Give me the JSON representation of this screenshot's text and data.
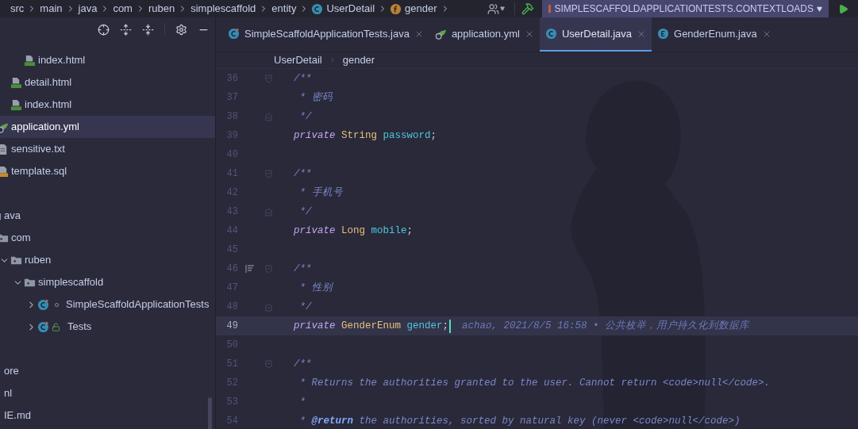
{
  "nav_bar": {
    "crumbs": [
      {
        "label": "src",
        "kind": "folder"
      },
      {
        "label": "main",
        "kind": "folder"
      },
      {
        "label": "java",
        "kind": "folder"
      },
      {
        "label": "com",
        "kind": "folder"
      },
      {
        "label": "ruben",
        "kind": "folder"
      },
      {
        "label": "simplescaffold",
        "kind": "folder"
      },
      {
        "label": "entity",
        "kind": "folder"
      },
      {
        "label": "UserDetail",
        "kind": "class"
      },
      {
        "label": "gender",
        "kind": "field"
      }
    ],
    "run_config": "SIMPLESCAFFOLDAPPLICATIONTESTS.CONTEXTLOADS"
  },
  "project_tree": {
    "sections": [
      {
        "items": [
          {
            "children": [
              {
                "children": [
                  {
                    "children": [
                      {
                        "label": "index.html",
                        "kind": "html",
                        "selected": false
                      }
                    ]
                  },
                  {
                    "label": "detail.html",
                    "kind": "html",
                    "selected": false
                  },
                  {
                    "label": "index.html",
                    "kind": "html",
                    "selected": false
                  }
                ]
              },
              {
                "label": "application.yml",
                "kind": "yaml",
                "selected": true
              },
              {
                "label": "sensitive.txt",
                "kind": "text",
                "selected": false
              },
              {
                "label": "template.sql",
                "kind": "sql",
                "selected": false
              }
            ]
          }
        ]
      },
      {
        "items": [
          {
            "label": "ava",
            "kind": "folder",
            "selected": false,
            "children": [
              {
                "label": "com",
                "kind": "package",
                "selected": false,
                "children": [
                  {
                    "label": "ruben",
                    "kind": "package",
                    "selected": false,
                    "expanded": true,
                    "children": [
                      {
                        "label": "simplescaffold",
                        "kind": "package",
                        "selected": false,
                        "expanded": true,
                        "children": [
                          {
                            "label": "SimpleScaffoldApplicationTests",
                            "kind": "test_class",
                            "public": false,
                            "selected": false,
                            "expanded": false
                          },
                          {
                            "label": "Tests",
                            "kind": "test_class",
                            "public": true,
                            "selected": false,
                            "expanded": false
                          }
                        ]
                      }
                    ]
                  }
                ]
              }
            ]
          }
        ]
      },
      {
        "items": [
          {
            "label": "ore",
            "kind": "file",
            "selected": false
          },
          {
            "label": "nl",
            "kind": "file",
            "selected": false
          },
          {
            "label": "IE.md",
            "kind": "file",
            "selected": false
          }
        ]
      }
    ]
  },
  "editor": {
    "tabs": [
      {
        "label": "SimpleScaffoldApplicationTests.java",
        "kind": "test_class",
        "selected": false
      },
      {
        "label": "application.yml",
        "kind": "yaml",
        "selected": false
      },
      {
        "label": "UserDetail.java",
        "kind": "class",
        "selected": true
      },
      {
        "label": "GenderEnum.java",
        "kind": "enum",
        "selected": false
      }
    ],
    "breadcrumb": [
      "UserDetail",
      "gender"
    ],
    "lines": [
      {
        "number": "36",
        "fold_start": true,
        "current": false,
        "tokens": [
          {
            "kind": "comment",
            "text": "/**"
          }
        ]
      },
      {
        "number": "37",
        "current": false,
        "tokens": [
          {
            "kind": "comment",
            "text": " * 密码"
          }
        ]
      },
      {
        "number": "38",
        "fold_end": true,
        "current": false,
        "tokens": [
          {
            "kind": "comment",
            "text": " */"
          }
        ]
      },
      {
        "number": "39",
        "current": false,
        "tokens": [
          {
            "kind": "keyword",
            "text": "private "
          },
          {
            "kind": "type",
            "text": "String "
          },
          {
            "kind": "field",
            "text": "password"
          },
          {
            "kind": "plain",
            "text": ";"
          }
        ]
      },
      {
        "number": "40",
        "current": false
      },
      {
        "number": "41",
        "fold_start": true,
        "current": false,
        "tokens": [
          {
            "kind": "comment",
            "text": "/**"
          }
        ]
      },
      {
        "number": "42",
        "current": false,
        "tokens": [
          {
            "kind": "comment",
            "text": " * 手机号"
          }
        ]
      },
      {
        "number": "43",
        "fold_end": true,
        "current": false,
        "tokens": [
          {
            "kind": "comment",
            "text": " */"
          }
        ]
      },
      {
        "number": "44",
        "current": false,
        "tokens": [
          {
            "kind": "keyword",
            "text": "private "
          },
          {
            "kind": "type",
            "text": "Long "
          },
          {
            "kind": "field",
            "text": "mobile"
          },
          {
            "kind": "plain",
            "text": ";"
          }
        ]
      },
      {
        "number": "45",
        "current": false
      },
      {
        "number": "46",
        "fold_start": true,
        "doc_toggle": true,
        "current": false,
        "tokens": [
          {
            "kind": "comment",
            "text": "/**"
          }
        ]
      },
      {
        "number": "47",
        "current": false,
        "tokens": [
          {
            "kind": "comment",
            "text": " * 性别"
          }
        ]
      },
      {
        "number": "48",
        "fold_end": true,
        "current": false,
        "tokens": [
          {
            "kind": "comment",
            "text": " */"
          }
        ]
      },
      {
        "number": "49",
        "current": true,
        "tokens": [
          {
            "kind": "keyword",
            "text": "private "
          },
          {
            "kind": "type",
            "text": "GenderEnum "
          },
          {
            "kind": "field",
            "text": "gender"
          },
          {
            "kind": "plain",
            "text": ";"
          }
        ],
        "blame": "achao, 2021/8/5 16:58 • 公共枚举，用户持久化到数据库"
      },
      {
        "number": "50",
        "current": false
      },
      {
        "number": "51",
        "fold_start": true,
        "current": false,
        "tokens": [
          {
            "kind": "comment",
            "text": "/**"
          }
        ]
      },
      {
        "number": "52",
        "current": false,
        "tokens": [
          {
            "kind": "comment",
            "text": " * Returns the authorities granted to the user. Cannot return <code>null</code>."
          }
        ]
      },
      {
        "number": "53",
        "current": false,
        "tokens": [
          {
            "kind": "comment",
            "text": " *"
          }
        ]
      },
      {
        "number": "54",
        "current": false,
        "tokens": [
          {
            "kind": "comment",
            "text": " * "
          },
          {
            "kind": "doc_tag",
            "text": "@return"
          },
          {
            "kind": "comment",
            "text": " the authorities, sorted by natural key (never <code>null</code>)"
          }
        ]
      }
    ]
  }
}
